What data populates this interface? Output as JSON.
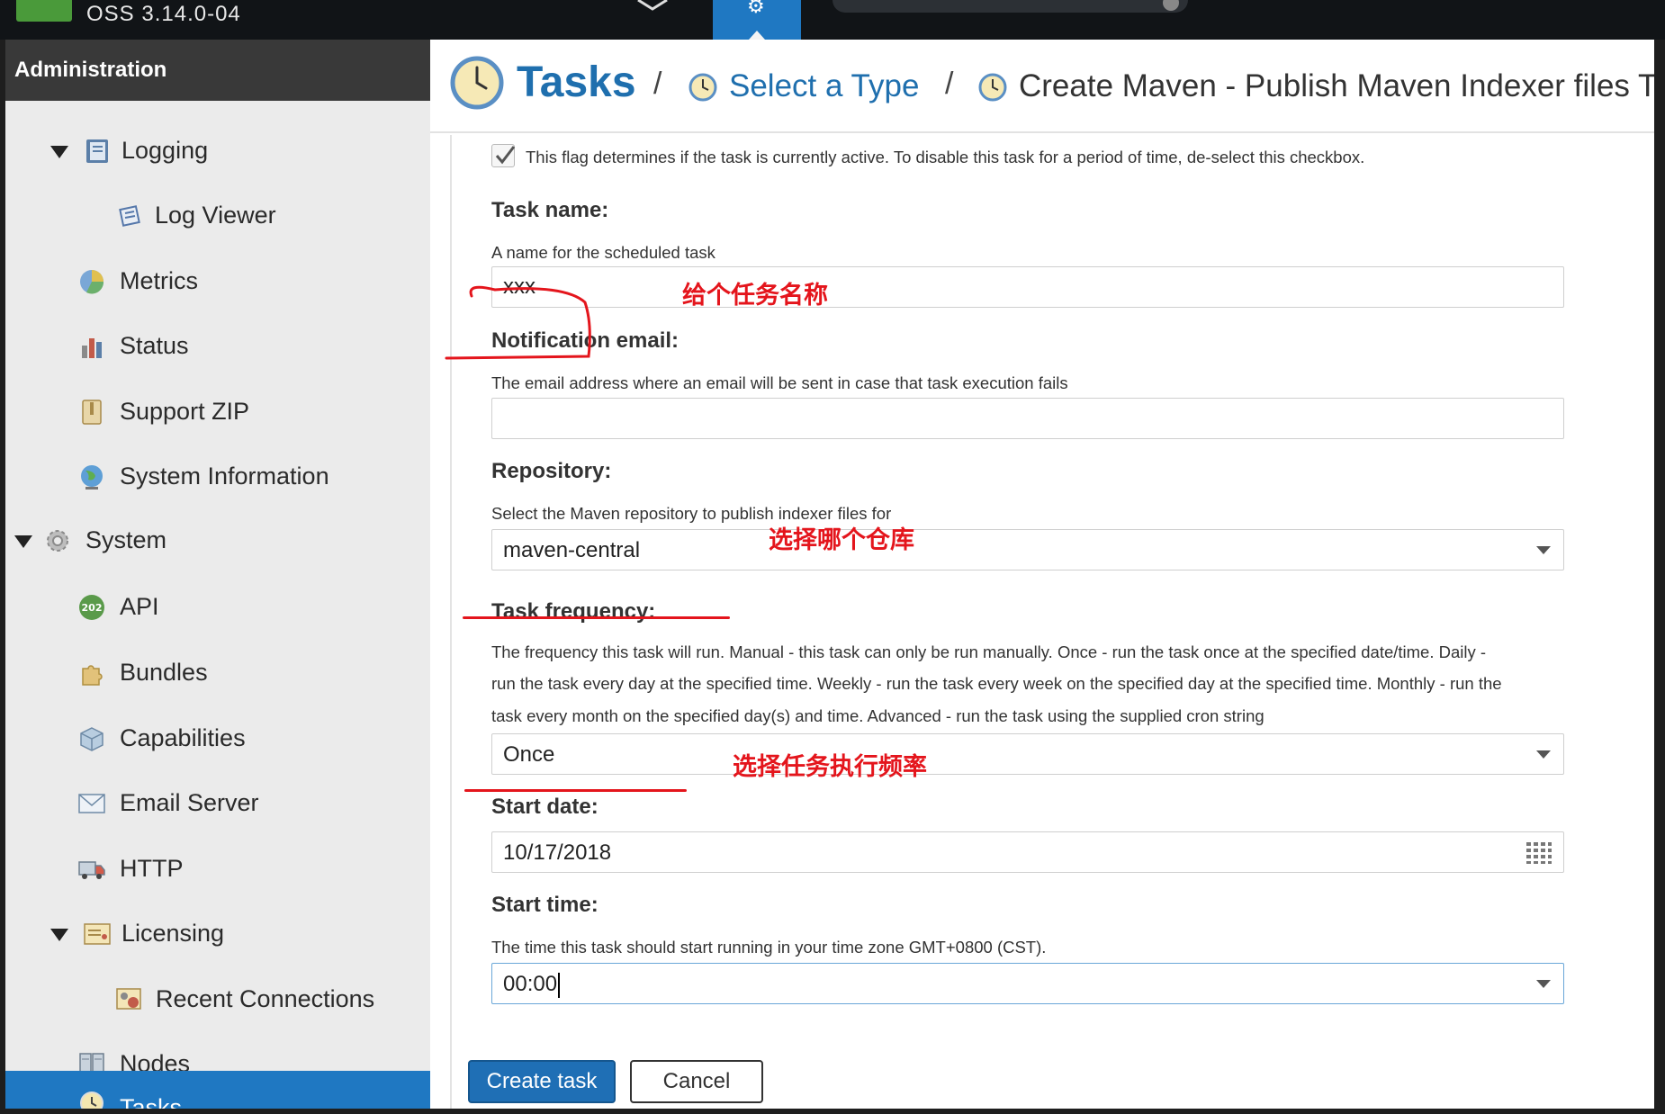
{
  "topbar": {
    "version": "OSS 3.14.0-04"
  },
  "sidebar": {
    "header": "Administration",
    "items": [
      {
        "label": "Logging",
        "icon": "book-icon"
      },
      {
        "label": "Log Viewer",
        "icon": "scroll-icon"
      },
      {
        "label": "Metrics",
        "icon": "pie-chart-icon"
      },
      {
        "label": "Status",
        "icon": "bar-chart-icon"
      },
      {
        "label": "Support ZIP",
        "icon": "zip-icon"
      },
      {
        "label": "System Information",
        "icon": "globe-icon"
      },
      {
        "label": "System",
        "icon": "gear-icon"
      },
      {
        "label": "API",
        "icon": "api-badge-icon",
        "badge": "202"
      },
      {
        "label": "Bundles",
        "icon": "puzzle-icon"
      },
      {
        "label": "Capabilities",
        "icon": "cube-icon"
      },
      {
        "label": "Email Server",
        "icon": "envelope-icon"
      },
      {
        "label": "HTTP",
        "icon": "truck-icon"
      },
      {
        "label": "Licensing",
        "icon": "certificate-icon"
      },
      {
        "label": "Recent Connections",
        "icon": "id-card-icon"
      },
      {
        "label": "Nodes",
        "icon": "server-icon"
      },
      {
        "label": "Tasks",
        "icon": "clock-icon"
      }
    ]
  },
  "breadcrumb": {
    "root": "Tasks",
    "sep": "/",
    "step2": "Select a Type",
    "step3": "Create Maven - Publish Maven Indexer files Ta"
  },
  "form": {
    "enabled_help": "This flag determines if the task is currently active. To disable this task for a period of time, de-select this checkbox.",
    "task_name_label": "Task name:",
    "task_name_help": "A name for the scheduled task",
    "task_name_value": "xxx",
    "email_label": "Notification email:",
    "email_help": "The email address where an email will be sent in case that task execution fails",
    "email_value": "",
    "repo_label": "Repository:",
    "repo_help": "Select the Maven repository to publish indexer files for",
    "repo_value": "maven-central",
    "freq_label": "Task frequency:",
    "freq_help_1": "The frequency this task will run. Manual - this task can only be run manually. Once - run the task once at the specified date/time. Daily -",
    "freq_help_2": "run the task every day at the specified time. Weekly - run the task every week on the specified day at the specified time. Monthly - run the",
    "freq_help_3": "task every month on the specified day(s) and time. Advanced - run the task using the supplied cron string",
    "freq_value": "Once",
    "start_date_label": "Start date:",
    "start_date_value": "10/17/2018",
    "start_time_label": "Start time:",
    "start_time_help": "The time this task should start running in your time zone GMT+0800 (CST).",
    "start_time_value": "00:00",
    "create_button": "Create task",
    "cancel_button": "Cancel"
  },
  "annotations": {
    "name": "给个任务名称",
    "repo": "选择哪个仓库",
    "freq": "选择任务执行频率",
    "color": "#e4151c"
  },
  "colors": {
    "accent": "#1f78c2",
    "link": "#1f6fae",
    "sidebar_bg": "#ebebeb",
    "topbar_bg": "#111417"
  }
}
